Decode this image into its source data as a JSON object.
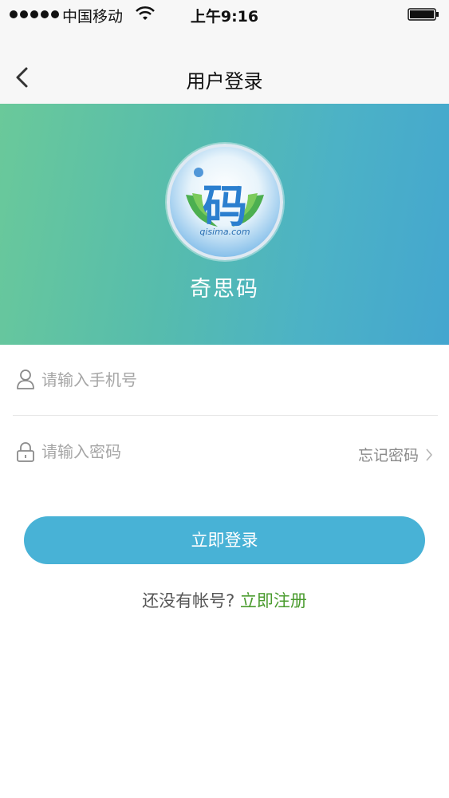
{
  "status_bar": {
    "carrier": "中国移动",
    "time": "上午9:16",
    "icons": [
      "signal-dots",
      "wifi-icon",
      "battery-icon"
    ]
  },
  "nav": {
    "title": "用户登录",
    "back_icon": "chevron-left-icon"
  },
  "hero": {
    "logo_char": "码",
    "logo_sub": "qisima.com",
    "app_name": "奇思码",
    "gradient": [
      "#6ac99a",
      "#44a6cf"
    ]
  },
  "form": {
    "phone_placeholder": "请输入手机号",
    "password_placeholder": "请输入密码",
    "forgot_password": "忘记密码",
    "login_button": "立即登录"
  },
  "register": {
    "prompt": "还没有帐号?",
    "link": "立即注册"
  },
  "colors": {
    "accent": "#48b2d6",
    "link_green": "#4a9b2e"
  }
}
